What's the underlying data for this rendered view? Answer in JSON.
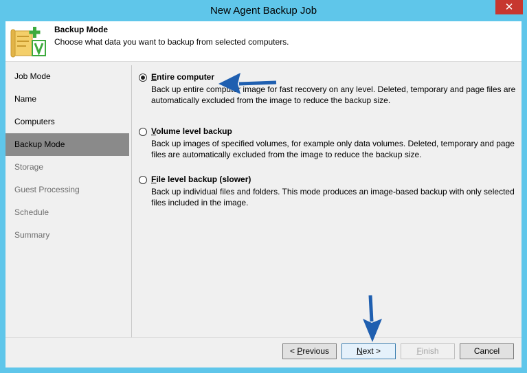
{
  "window": {
    "title": "New Agent Backup Job",
    "close_glyph": "✕"
  },
  "header": {
    "title": "Backup Mode",
    "description": "Choose what data you want to backup from selected computers."
  },
  "steps": [
    {
      "label": "Job Mode",
      "state": "enabled"
    },
    {
      "label": "Name",
      "state": "enabled"
    },
    {
      "label": "Computers",
      "state": "enabled"
    },
    {
      "label": "Backup Mode",
      "state": "active"
    },
    {
      "label": "Storage",
      "state": "disabled"
    },
    {
      "label": "Guest Processing",
      "state": "disabled"
    },
    {
      "label": "Schedule",
      "state": "disabled"
    },
    {
      "label": "Summary",
      "state": "disabled"
    }
  ],
  "options": [
    {
      "label_u": "E",
      "label_rest": "ntire computer",
      "selected": true,
      "description": "Back up entire computer image for fast recovery on any level. Deleted, temporary and page files are automatically excluded from the image to reduce the backup size."
    },
    {
      "label_u": "V",
      "label_rest": "olume level backup",
      "selected": false,
      "description": "Back up images of specified volumes, for example only data volumes. Deleted, temporary and page files are automatically excluded from the image to reduce the backup size."
    },
    {
      "label_u": "F",
      "label_rest": "ile level backup (slower)",
      "selected": false,
      "description": "Back up individual files and folders. This mode produces an image-based backup with only selected files included in the image."
    }
  ],
  "buttons": {
    "previous": {
      "prefix": "< ",
      "u": "P",
      "rest": "revious"
    },
    "next": {
      "u": "N",
      "rest": "ext >"
    },
    "finish": {
      "u": "F",
      "rest": "inish"
    },
    "cancel": "Cancel"
  },
  "colors": {
    "titlebar": "#5fc6ea",
    "close": "#c7372f",
    "active_step": "#8a8a8a",
    "annotation_arrow": "#1f5fb0"
  }
}
